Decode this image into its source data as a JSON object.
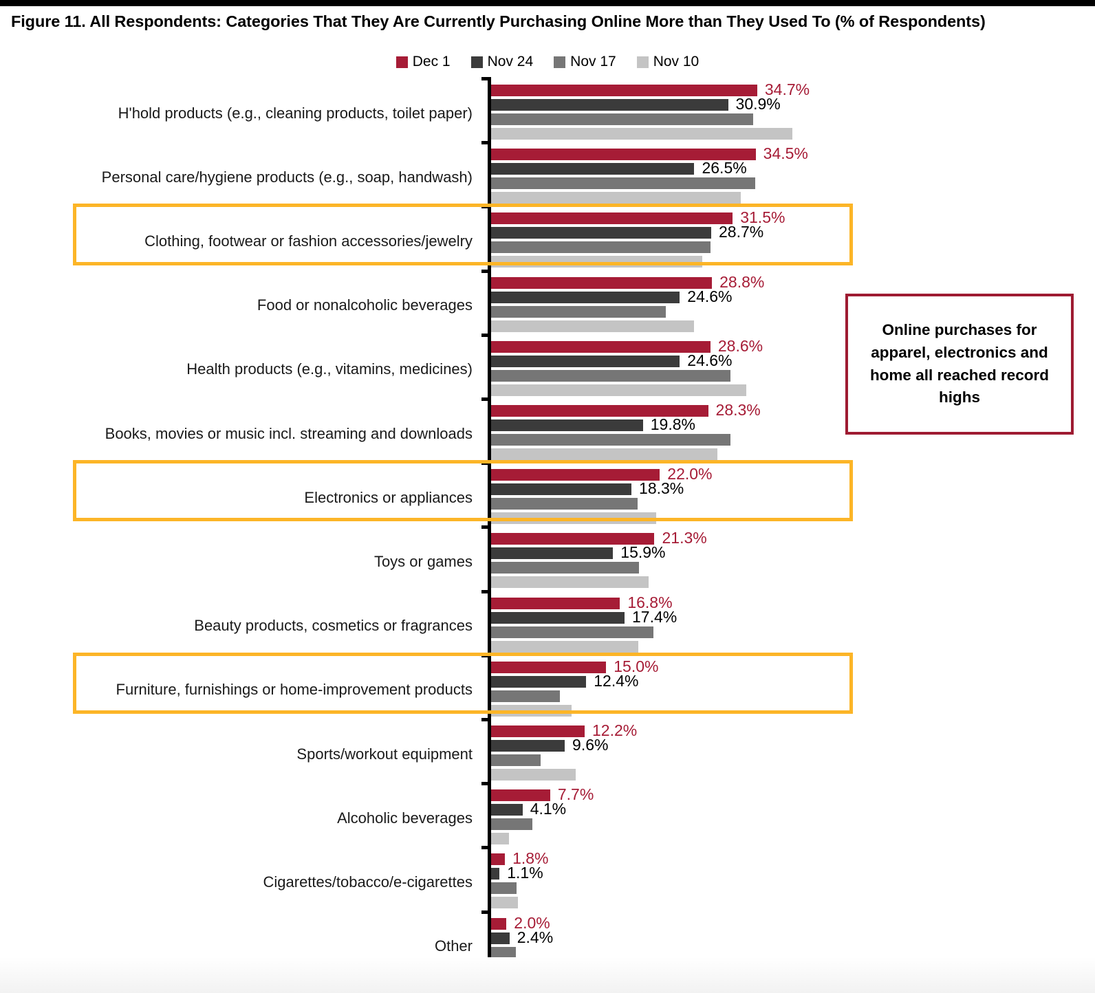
{
  "title": "Figure 11. All Respondents: Categories That They Are Currently Purchasing Online More than They Used To (% of Respondents)",
  "callout": {
    "text": "Online purchases for apparel, electronics and home all reached record highs"
  },
  "colors": {
    "dec1": "#a61c36",
    "nov24": "#3b3b3b",
    "nov17": "#767676",
    "nov10": "#c4c4c4",
    "highlight": "#fcb527",
    "callout_border": "#9e1b32"
  },
  "chart_data": {
    "type": "bar",
    "orientation": "horizontal",
    "title": "Figure 11. All Respondents: Categories That They Are Currently Purchasing Online More than They Used To (% of Respondents)",
    "xlabel": "",
    "ylabel": "",
    "xlim": [
      0,
      44
    ],
    "grid": false,
    "legend_position": "top-center",
    "legend": [
      "Dec 1",
      "Nov 24",
      "Nov 17",
      "Nov 10"
    ],
    "value_labels_shown_for": [
      "Dec 1",
      "Nov 24"
    ],
    "categories": [
      "H'hold products (e.g., cleaning products, toilet paper)",
      "Personal care/hygiene products (e.g., soap, handwash)",
      "Clothing, footwear or fashion accessories/jewelry",
      "Food or nonalcoholic beverages",
      "Health products (e.g., vitamins, medicines)",
      "Books, movies or music incl. streaming and downloads",
      "Electronics or appliances",
      "Toys or games",
      "Beauty products, cosmetics or fragrances",
      "Furniture, furnishings or home-improvement products",
      "Sports/workout equipment",
      "Alcoholic beverages",
      "Cigarettes/tobacco/e-cigarettes",
      "Other"
    ],
    "highlighted_categories": [
      "Clothing, footwear or fashion accessories/jewelry",
      "Electronics or appliances",
      "Furniture, furnishings or home-improvement products"
    ],
    "series": [
      {
        "name": "Dec 1",
        "color": "#a61c36",
        "values": [
          34.7,
          34.5,
          31.5,
          28.8,
          28.6,
          28.3,
          22.0,
          21.3,
          16.8,
          15.0,
          12.2,
          7.7,
          1.8,
          2.0
        ],
        "labels": [
          "34.7%",
          "34.5%",
          "31.5%",
          "28.8%",
          "28.6%",
          "28.3%",
          "22.0%",
          "21.3%",
          "16.8%",
          "15.0%",
          "12.2%",
          "7.7%",
          "1.8%",
          "2.0%"
        ]
      },
      {
        "name": "Nov 24",
        "color": "#3b3b3b",
        "values": [
          30.9,
          26.5,
          28.7,
          24.6,
          24.6,
          19.8,
          18.3,
          15.9,
          17.4,
          12.4,
          9.6,
          4.1,
          1.1,
          2.4
        ],
        "labels": [
          "30.9%",
          "26.5%",
          "28.7%",
          "24.6%",
          "24.6%",
          "19.8%",
          "18.3%",
          "15.9%",
          "17.4%",
          "12.4%",
          "9.6%",
          "4.1%",
          "1.1%",
          "2.4%"
        ]
      },
      {
        "name": "Nov 17",
        "color": "#767676",
        "values": [
          34.2,
          34.4,
          28.6,
          22.8,
          31.2,
          31.2,
          19.1,
          19.3,
          21.2,
          9.0,
          6.5,
          5.4,
          3.3,
          3.2
        ],
        "labels": [
          "",
          "",
          "",
          "",
          "",
          "",
          "",
          "",
          "",
          "",
          "",
          "",
          "",
          ""
        ]
      },
      {
        "name": "Nov 10",
        "color": "#c4c4c4",
        "values": [
          39.3,
          32.6,
          27.5,
          26.5,
          33.3,
          29.5,
          21.5,
          20.5,
          19.2,
          10.5,
          11.0,
          2.3,
          3.5,
          0.9
        ],
        "labels": [
          "",
          "",
          "",
          "",
          "",
          "",
          "",
          "",
          "",
          "",
          "",
          "",
          "",
          ""
        ]
      }
    ]
  }
}
